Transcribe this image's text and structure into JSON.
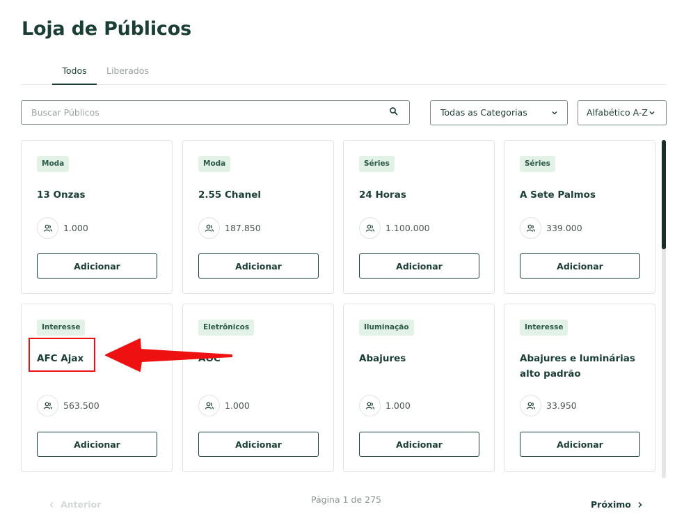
{
  "page": {
    "title": "Loja de Públicos"
  },
  "tabs": [
    {
      "label": "Todos",
      "active": true
    },
    {
      "label": "Liberados",
      "active": false
    }
  ],
  "search": {
    "placeholder": "Buscar Públicos",
    "value": ""
  },
  "filters": {
    "category": "Todas as Categorias",
    "sort": "Alfabético A-Z"
  },
  "cards": [
    {
      "category": "Moda",
      "name": "13 Onzas",
      "count": "1.000",
      "button": "Adicionar"
    },
    {
      "category": "Moda",
      "name": "2.55 Chanel",
      "count": "187.850",
      "button": "Adicionar"
    },
    {
      "category": "Séries",
      "name": "24 Horas",
      "count": "1.100.000",
      "button": "Adicionar"
    },
    {
      "category": "Séries",
      "name": "A Sete Palmos",
      "count": "339.000",
      "button": "Adicionar"
    },
    {
      "category": "Interesse",
      "name": "AFC Ajax",
      "count": "563.500",
      "button": "Adicionar"
    },
    {
      "category": "Eletrônicos",
      "name": "AOC",
      "count": "1.000",
      "button": "Adicionar"
    },
    {
      "category": "Iluminação",
      "name": "Abajures",
      "count": "1.000",
      "button": "Adicionar"
    },
    {
      "category": "Interesse",
      "name": "Abajures e luminárias alto padrão",
      "count": "33.950",
      "button": "Adicionar"
    }
  ],
  "pagination": {
    "previous": "Anterior",
    "info": "Página 1 de 275",
    "next": "Próximo"
  },
  "icons": {
    "search": "search-icon",
    "chevron": "chevron-down-icon",
    "audience": "users-icon",
    "prev": "chevron-left-icon",
    "next": "chevron-right-icon"
  },
  "colors": {
    "brand": "#1a3d35",
    "badge_bg": "#e3f2e7",
    "annotation": "#ee1111"
  }
}
